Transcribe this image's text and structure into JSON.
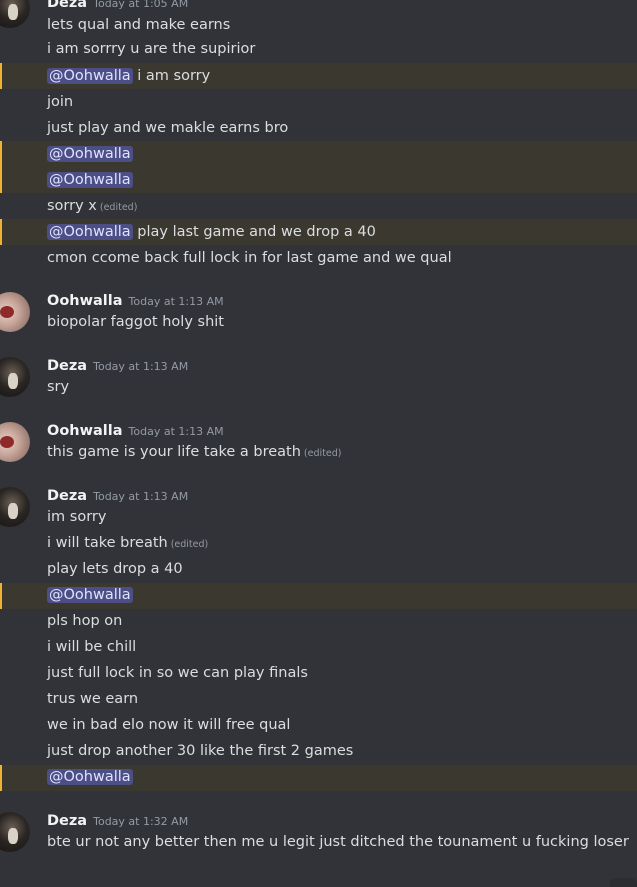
{
  "groups": [
    {
      "author": "Deza",
      "timestamp": "Today at 1:05 AM",
      "avatar": "deza-avatar"
    },
    {
      "author": "Oohwalla",
      "timestamp": "Today at 1:13 AM",
      "avatar": "oohwalla-avatar"
    },
    {
      "author": "Deza",
      "timestamp": "Today at 1:13 AM",
      "avatar": "deza-avatar"
    },
    {
      "author": "Oohwalla",
      "timestamp": "Today at 1:13 AM",
      "avatar": "oohwalla-avatar"
    },
    {
      "author": "Deza",
      "timestamp": "Today at 1:13 AM",
      "avatar": "deza-avatar"
    },
    {
      "author": "Deza",
      "timestamp": "Today at 1:32 AM",
      "avatar": "deza-avatar"
    }
  ],
  "messages": [
    {
      "text": "lets qual and make earns"
    },
    {
      "text": "i am sorrry u are the supirior"
    },
    {
      "mention": "@Oohwalla",
      "text": " i am sorry"
    },
    {
      "text": "join"
    },
    {
      "text": "just play and we makle earns bro"
    },
    {
      "mention": "@Oohwalla",
      "text": ""
    },
    {
      "mention": "@Oohwalla",
      "text": ""
    },
    {
      "text": "sorry x",
      "edited": "(edited)"
    },
    {
      "mention": "@Oohwalla",
      "text": " play last game and we drop a 40"
    },
    {
      "text": "cmon ccome back full lock in for last game and we qual"
    },
    {
      "text": "biopolar faggot holy shit"
    },
    {
      "text": "sry"
    },
    {
      "text": "this game is your life take a breath",
      "edited": "(edited)"
    },
    {
      "text": "im sorry"
    },
    {
      "text": "i will take breath",
      "edited": "(edited)"
    },
    {
      "text": "play lets drop a 40"
    },
    {
      "mention": "@Oohwalla",
      "text": ""
    },
    {
      "text": "pls hop on"
    },
    {
      "text": "i will be chill"
    },
    {
      "text": "just full lock in so we can play finals"
    },
    {
      "text": "trus we earn"
    },
    {
      "text": "we in bad elo now it will free qual"
    },
    {
      "text": "just drop another 30 like the first 2 games"
    },
    {
      "mention": "@Oohwalla",
      "text": ""
    },
    {
      "text": "bte ur not any better then me u legit just ditched the tounament u fucking loser"
    }
  ],
  "colors": {
    "background": "#313338",
    "mention_highlight": "#3b382f",
    "mention_chip": "#4b4f86"
  }
}
